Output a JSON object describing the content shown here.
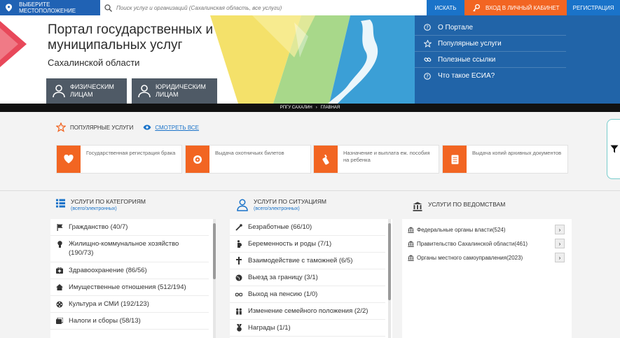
{
  "topbar": {
    "location_label": "Выберите местоположение",
    "search_placeholder": "Поиск услуг и организаций (Сахалинская область, все услуги)",
    "search_button": "Искать",
    "login_button": "Вход в личный кабинет",
    "register_button": "Регистрация"
  },
  "banner": {
    "title": "Портал государственных и муниципальных услуг",
    "region": "Сахалинской области",
    "audience_buttons": [
      {
        "label": "Физическим лицам",
        "icon": "person-icon"
      },
      {
        "label": "Юридическим лицам",
        "icon": "person-icon"
      }
    ],
    "menu": [
      {
        "label": "О Портале",
        "icon": "question-circle-icon"
      },
      {
        "label": "Популярные услуги",
        "icon": "star-icon"
      },
      {
        "label": "Полезные ссылки",
        "icon": "link-icon"
      },
      {
        "label": "Что такое ЕСИА?",
        "icon": "question-circle-icon"
      }
    ]
  },
  "breadcrumb": {
    "items": [
      "РПГУ Сахалин",
      "Главная"
    ]
  },
  "popular": {
    "heading": "Популярные услуги",
    "see_all": "Смотреть все",
    "cards": [
      {
        "label": "Государственная регистрация брака",
        "icon": "heart-icon"
      },
      {
        "label": "Выдача охотничьих билетов",
        "icon": "target-icon"
      },
      {
        "label": "Назначение и выплата еж. пособия на ребенка",
        "icon": "baby-bottle-icon"
      },
      {
        "label": "Выдача копий архивных документов",
        "icon": "document-icon"
      }
    ]
  },
  "categories": {
    "title": "Услуги по категориям",
    "subtitle": "(всего/электронных)",
    "items": [
      {
        "label": "Гражданство (40/7)",
        "icon": "flag-icon"
      },
      {
        "label": "Жилищно-коммунальное хозяйство (190/73)",
        "icon": "bulb-icon"
      },
      {
        "label": "Здравоохранение (86/56)",
        "icon": "medkit-icon"
      },
      {
        "label": "Имущественные отношения (512/194)",
        "icon": "house-icon"
      },
      {
        "label": "Культура и СМИ (192/123)",
        "icon": "film-icon"
      },
      {
        "label": "Налоги и сборы (58/13)",
        "icon": "tax-icon"
      }
    ]
  },
  "situations": {
    "title": "Услуги по ситуациям",
    "subtitle": "(всего/электронных)",
    "items": [
      {
        "label": "Безработные (66/10)",
        "icon": "tools-icon"
      },
      {
        "label": "Беременность и роды (7/1)",
        "icon": "pregnant-icon"
      },
      {
        "label": "Взаимодействие с таможней (6/5)",
        "icon": "customs-icon"
      },
      {
        "label": "Выезд за границу (3/1)",
        "icon": "globe-icon"
      },
      {
        "label": "Выход на пенсию (1/0)",
        "icon": "glasses-icon"
      },
      {
        "label": "Изменение семейного положения (2/2)",
        "icon": "family-icon"
      },
      {
        "label": "Награды (1/1)",
        "icon": "medal-icon"
      }
    ]
  },
  "departments": {
    "title": "Услуги по ведомствам",
    "items": [
      {
        "label": "Федеральные органы власти(524)"
      },
      {
        "label": "Правительство Сахалинской области(461)"
      },
      {
        "label": "Органы местного самоуправления(2023)"
      }
    ]
  },
  "colors": {
    "primary_blue": "#1a73c9",
    "accent_orange": "#f26522",
    "dark_button": "#4f5a66"
  }
}
